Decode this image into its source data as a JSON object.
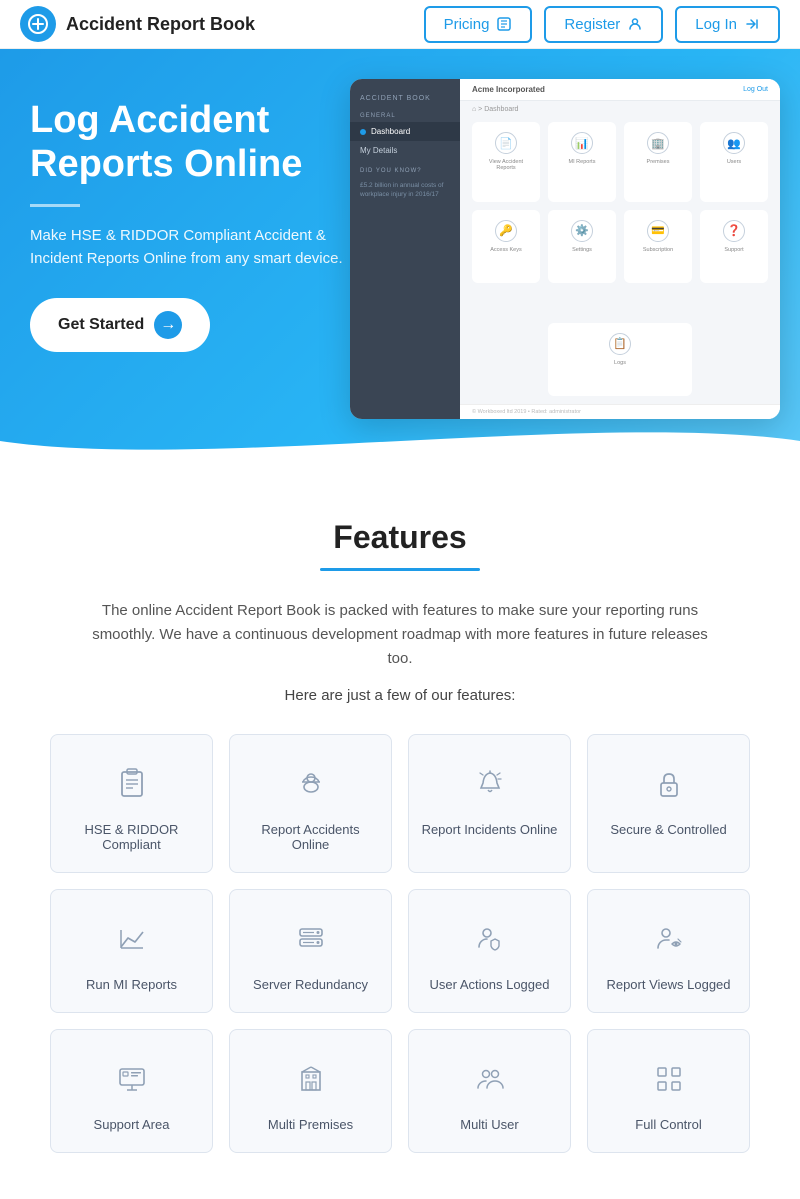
{
  "header": {
    "logo_icon": "+",
    "logo_text": "Accident Report Book",
    "nav": [
      {
        "label": "Pricing",
        "icon": "🏷"
      },
      {
        "label": "Register",
        "icon": "👤"
      },
      {
        "label": "Log In",
        "icon": "→"
      }
    ]
  },
  "hero": {
    "title": "Log Accident Reports Online",
    "divider": true,
    "subtitle": "Make HSE & RIDDOR Compliant Accident & Incident Reports Online from any smart device.",
    "cta_label": "Get Started"
  },
  "mockup": {
    "sidebar_title": "ACCIDENT BOOK",
    "company": "Acme Incorporated",
    "logout": "Log Out",
    "section_general": "GENERAL",
    "item_dashboard": "Dashboard",
    "item_my_details": "My Details",
    "section_did_you_know": "DID YOU KNOW?",
    "info_text": "£5.2 billion in annual costs of workplace injury in 2016/17",
    "breadcrumb": "⌂ > Dashboard",
    "cards": [
      {
        "label": "View Accident Reports"
      },
      {
        "label": "MI Reports"
      },
      {
        "label": "Premises"
      },
      {
        "label": "Users"
      },
      {
        "label": "Access Keys"
      },
      {
        "label": "Settings"
      },
      {
        "label": "Subscription"
      },
      {
        "label": "Support"
      },
      {
        "label": "Logs"
      }
    ],
    "footer_text": "© Workboxed ltd 2019 • Rated: administrator"
  },
  "features": {
    "title": "Features",
    "description": "The online Accident Report Book is packed with features to make sure your reporting runs smoothly. We have a continuous development roadmap with more features in future releases too.",
    "sub_text": "Here are just a few of our features:",
    "cards_row1": [
      {
        "label": "HSE & RIDDOR Compliant",
        "icon": "clipboard"
      },
      {
        "label": "Report Accidents Online",
        "icon": "person-hard-hat"
      },
      {
        "label": "Report Incidents Online",
        "icon": "alert-bell"
      },
      {
        "label": "Secure & Controlled",
        "icon": "lock"
      }
    ],
    "cards_row2": [
      {
        "label": "Run MI Reports",
        "icon": "chart"
      },
      {
        "label": "Server Redundancy",
        "icon": "server"
      },
      {
        "label": "User Actions Logged",
        "icon": "user-shield"
      },
      {
        "label": "Report Views Logged",
        "icon": "user-eye"
      }
    ],
    "cards_row3": [
      {
        "label": "Support Area",
        "icon": "monitor"
      },
      {
        "label": "Multi Premises",
        "icon": "building"
      },
      {
        "label": "Multi User",
        "icon": "group"
      },
      {
        "label": "Full Control",
        "icon": "grid"
      }
    ]
  }
}
